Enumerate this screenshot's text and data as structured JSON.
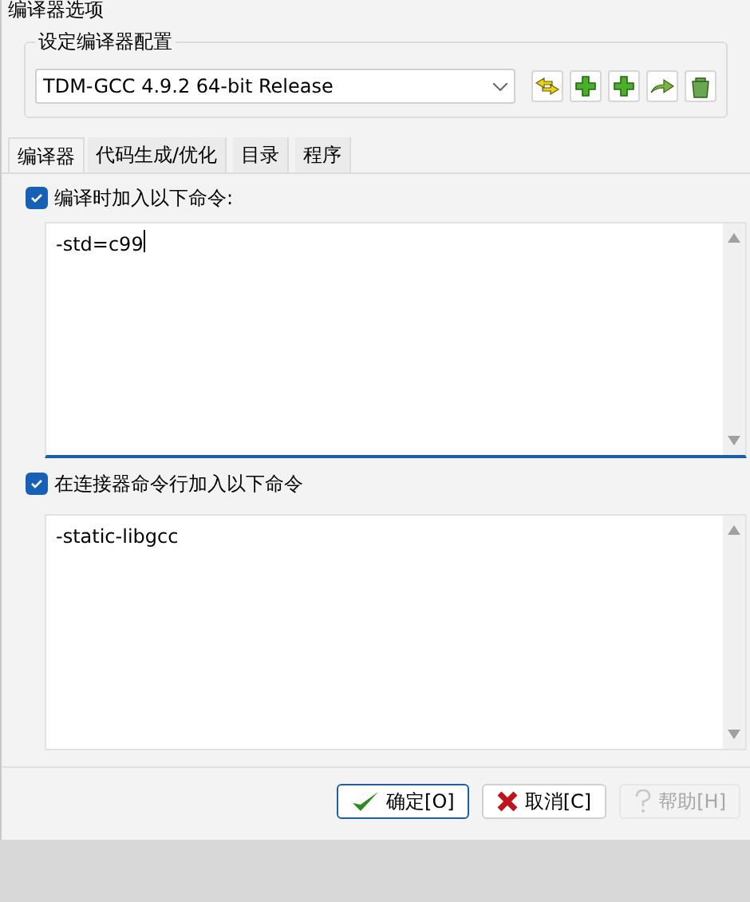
{
  "window": {
    "title": "编译器选项"
  },
  "compiler_set": {
    "label": "设定编译器配置",
    "value": "TDM-GCC 4.9.2 64-bit Release"
  },
  "tabs": [
    {
      "label": "编译器",
      "selected": true
    },
    {
      "label": "代码生成/优化",
      "selected": false
    },
    {
      "label": "目录",
      "selected": false
    },
    {
      "label": "程序",
      "selected": false
    }
  ],
  "compiler_commands": {
    "label": "编译时加入以下命令:",
    "checked": true,
    "value": "-std=c99"
  },
  "linker_commands": {
    "label": "在连接器命令行加入以下命令",
    "checked": true,
    "value": "-static-libgcc"
  },
  "buttons": [
    {
      "label": "确定[O]",
      "kind": "ok",
      "disabled": false
    },
    {
      "label": "取消[C]",
      "kind": "cancel",
      "disabled": false
    },
    {
      "label": "帮助[H]",
      "kind": "help",
      "disabled": true
    }
  ]
}
